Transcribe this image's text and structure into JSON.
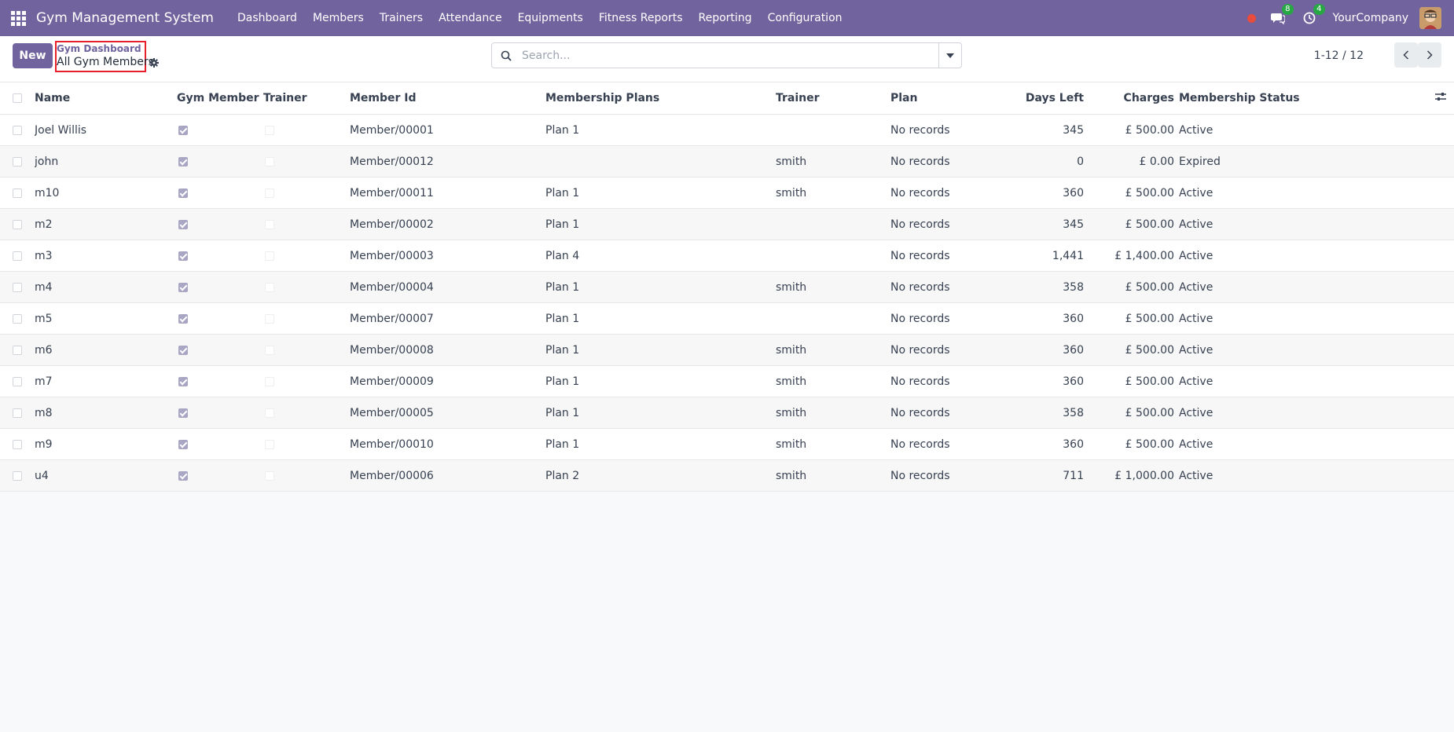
{
  "navbar": {
    "brand": "Gym Management System",
    "menu": [
      "Dashboard",
      "Members",
      "Trainers",
      "Attendance",
      "Equipments",
      "Fitness Reports",
      "Reporting",
      "Configuration"
    ],
    "messages_count": "8",
    "activities_count": "4",
    "company": "YourCompany"
  },
  "control_panel": {
    "new_label": "New",
    "breadcrumb_parent": "Gym Dashboard",
    "breadcrumb_current": "All Gym Members",
    "search_placeholder": "Search...",
    "pager": "1-12 / 12"
  },
  "table": {
    "headers": {
      "name": "Name",
      "gym_member": "Gym Member",
      "trainer_flag": "Trainer",
      "member_id": "Member Id",
      "membership_plans": "Membership Plans",
      "trainer": "Trainer",
      "plan": "Plan",
      "days_left": "Days Left",
      "charges": "Charges",
      "status": "Membership Status"
    },
    "rows": [
      {
        "name": "Joel Willis",
        "member_id": "Member/00001",
        "plans": "Plan 1",
        "trainer": "",
        "plan": "No records",
        "days": "345",
        "charges": "£ 500.00",
        "status": "Active"
      },
      {
        "name": "john",
        "member_id": "Member/00012",
        "plans": "",
        "trainer": "smith",
        "plan": "No records",
        "days": "0",
        "charges": "£ 0.00",
        "status": "Expired"
      },
      {
        "name": "m10",
        "member_id": "Member/00011",
        "plans": "Plan 1",
        "trainer": "smith",
        "plan": "No records",
        "days": "360",
        "charges": "£ 500.00",
        "status": "Active"
      },
      {
        "name": "m2",
        "member_id": "Member/00002",
        "plans": "Plan 1",
        "trainer": "",
        "plan": "No records",
        "days": "345",
        "charges": "£ 500.00",
        "status": "Active"
      },
      {
        "name": "m3",
        "member_id": "Member/00003",
        "plans": "Plan 4",
        "trainer": "",
        "plan": "No records",
        "days": "1,441",
        "charges": "£ 1,400.00",
        "status": "Active"
      },
      {
        "name": "m4",
        "member_id": "Member/00004",
        "plans": "Plan 1",
        "trainer": "smith",
        "plan": "No records",
        "days": "358",
        "charges": "£ 500.00",
        "status": "Active"
      },
      {
        "name": "m5",
        "member_id": "Member/00007",
        "plans": "Plan 1",
        "trainer": "",
        "plan": "No records",
        "days": "360",
        "charges": "£ 500.00",
        "status": "Active"
      },
      {
        "name": "m6",
        "member_id": "Member/00008",
        "plans": "Plan 1",
        "trainer": "smith",
        "plan": "No records",
        "days": "360",
        "charges": "£ 500.00",
        "status": "Active"
      },
      {
        "name": "m7",
        "member_id": "Member/00009",
        "plans": "Plan 1",
        "trainer": "smith",
        "plan": "No records",
        "days": "360",
        "charges": "£ 500.00",
        "status": "Active"
      },
      {
        "name": "m8",
        "member_id": "Member/00005",
        "plans": "Plan 1",
        "trainer": "smith",
        "plan": "No records",
        "days": "358",
        "charges": "£ 500.00",
        "status": "Active"
      },
      {
        "name": "m9",
        "member_id": "Member/00010",
        "plans": "Plan 1",
        "trainer": "smith",
        "plan": "No records",
        "days": "360",
        "charges": "£ 500.00",
        "status": "Active"
      },
      {
        "name": "u4",
        "member_id": "Member/00006",
        "plans": "Plan 2",
        "trainer": "smith",
        "plan": "No records",
        "days": "711",
        "charges": "£ 1,000.00",
        "status": "Active"
      }
    ]
  },
  "icons": {
    "apps": "apps-grid-icon",
    "search": "search-icon",
    "gear": "gear-icon",
    "optional_columns": "sliders-icon"
  },
  "colors": {
    "brand": "#71639e",
    "highlight_border": "#e8202a",
    "badge": "#28a745",
    "record_dot": "#e74c3c"
  }
}
